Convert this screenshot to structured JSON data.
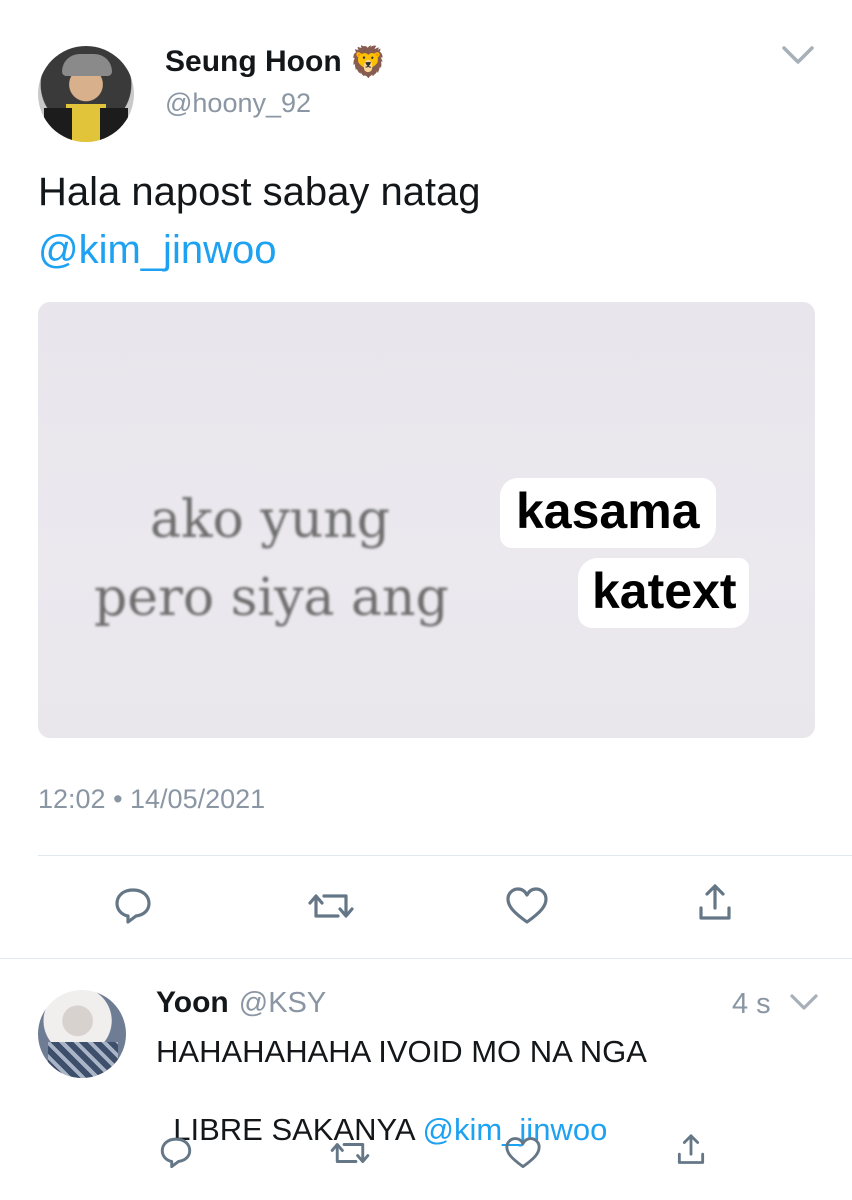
{
  "tweet": {
    "author_name": "Seung Hoon",
    "author_emoji": "🦁",
    "author_handle": "@hoony_92",
    "text_line1": "Hala napost sabay natag",
    "mention": "@kim_jinwoo",
    "timestamp": "12:02 • 14/05/2021",
    "media": {
      "line1_text": "ako yung",
      "line1_sticker": "kasama",
      "line2_text": "pero siya ang",
      "line2_sticker": "katext"
    }
  },
  "reply": {
    "author_name": "Yoon",
    "author_handle": "@KSY",
    "time": "4 s",
    "text_line1": "HAHAHAHAHA IVOID MO NA NGA",
    "text_line2": "LIBRE SAKANYA ",
    "mention": "@kim_jinwoo"
  },
  "icons": [
    "chevron-down-icon",
    "reply-icon",
    "retweet-icon",
    "like-icon",
    "share-icon"
  ],
  "colors": {
    "link": "#1da1f2",
    "icon": "#657786",
    "secondary_text": "#8a96a3",
    "divider": "#e1e8ed"
  }
}
